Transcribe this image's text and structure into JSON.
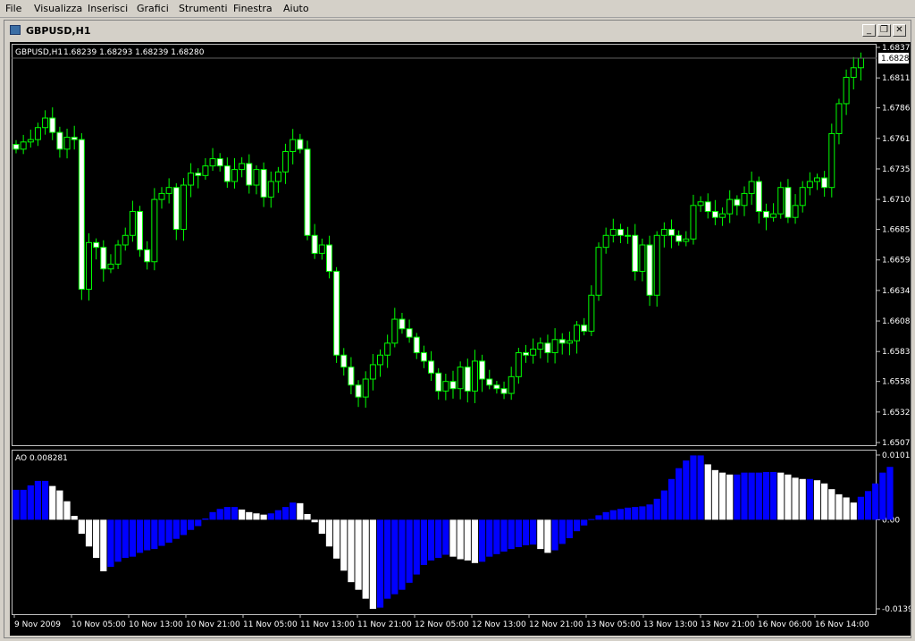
{
  "menu": [
    "File",
    "Visualizza",
    "Inserisci",
    "Grafici",
    "Strumenti",
    "Finestra",
    "Aiuto"
  ],
  "window": {
    "title": "GBPUSD,H1",
    "minimize": "_",
    "restore": "❐",
    "close": "✕"
  },
  "colors": {
    "background": "#000000",
    "candle": "#00ff00",
    "bull_body": "#000000",
    "bear_body": "#ffffff",
    "ao_up": "#0000ff",
    "ao_down": "#ffffff",
    "text": "#ffffff",
    "grid": "#606060"
  },
  "chart_data": [
    {
      "type": "candlestick",
      "title": "GBPUSD,H1",
      "ohlc_label": "1.68239 1.68293 1.68239 1.68280",
      "current_price": "1.68280",
      "ylim": [
        1.6507,
        1.6837
      ],
      "y_ticks": [
        "1.68370",
        "1.68115",
        "1.67865",
        "1.67610",
        "1.67355",
        "1.67100",
        "1.66850",
        "1.66595",
        "1.66340",
        "1.66085",
        "1.65830",
        "1.65580",
        "1.65325",
        "1.65070"
      ],
      "x_ticks": [
        "9 Nov 2009",
        "10 Nov 05:00",
        "10 Nov 13:00",
        "10 Nov 21:00",
        "11 Nov 05:00",
        "11 Nov 13:00",
        "11 Nov 21:00",
        "12 Nov 05:00",
        "12 Nov 13:00",
        "12 Nov 21:00",
        "13 Nov 05:00",
        "13 Nov 13:00",
        "13 Nov 21:00",
        "16 Nov 06:00",
        "16 Nov 14:00"
      ],
      "close": [
        1.6752,
        1.6758,
        1.676,
        1.677,
        1.6778,
        1.6766,
        1.6752,
        1.6762,
        1.676,
        1.6635,
        1.6674,
        1.667,
        1.6652,
        1.6656,
        1.6672,
        1.668,
        1.67,
        1.6668,
        1.6658,
        1.671,
        1.6715,
        1.672,
        1.6685,
        1.6722,
        1.6732,
        1.673,
        1.6738,
        1.6744,
        1.6738,
        1.6725,
        1.6735,
        1.674,
        1.6722,
        1.6735,
        1.6712,
        1.6725,
        1.6733,
        1.675,
        1.676,
        1.6752,
        1.668,
        1.6665,
        1.6672,
        1.665,
        1.658,
        1.657,
        1.6555,
        1.6545,
        1.656,
        1.6572,
        1.658,
        1.659,
        1.661,
        1.6602,
        1.6595,
        1.6582,
        1.6575,
        1.6565,
        1.655,
        1.6558,
        1.6552,
        1.657,
        1.655,
        1.6575,
        1.656,
        1.6555,
        1.6552,
        1.6548,
        1.6562,
        1.6582,
        1.658,
        1.6585,
        1.659,
        1.6582,
        1.6593,
        1.659,
        1.6592,
        1.6605,
        1.66,
        1.663,
        1.667,
        1.668,
        1.6685,
        1.668,
        1.668,
        1.665,
        1.6672,
        1.663,
        1.668,
        1.6685,
        1.668,
        1.6675,
        1.6677,
        1.6705,
        1.6708,
        1.67,
        1.6695,
        1.6698,
        1.671,
        1.6705,
        1.6715,
        1.6725,
        1.67,
        1.6695,
        1.6698,
        1.672,
        1.6695,
        1.6705,
        1.672,
        1.6725,
        1.6728,
        1.672,
        1.6765,
        1.679,
        1.6812,
        1.682,
        1.6828
      ]
    },
    {
      "type": "bar",
      "title": "AO 0.008281",
      "ylim": [
        -0.01399,
        0.01016
      ],
      "y_ticks": [
        "0.010163",
        "0.00",
        "-0.013990"
      ],
      "values": [
        0.0047,
        0.0047,
        0.0054,
        0.0061,
        0.0061,
        0.0053,
        0.0046,
        0.0029,
        0.0006,
        -0.0022,
        -0.0042,
        -0.006,
        -0.0081,
        -0.0074,
        -0.0066,
        -0.006,
        -0.0058,
        -0.0052,
        -0.0048,
        -0.0046,
        -0.0041,
        -0.0036,
        -0.003,
        -0.0024,
        -0.0016,
        -0.001,
        0.0002,
        0.0012,
        0.0017,
        0.002,
        0.002,
        0.0016,
        0.0012,
        0.001,
        0.0008,
        0.001,
        0.0015,
        0.002,
        0.0027,
        0.0026,
        0.0009,
        -0.0004,
        -0.0022,
        -0.0042,
        -0.0061,
        -0.008,
        -0.0098,
        -0.011,
        -0.0124,
        -0.014,
        -0.0138,
        -0.0124,
        -0.0117,
        -0.011,
        -0.0099,
        -0.0086,
        -0.0071,
        -0.0064,
        -0.006,
        -0.0055,
        -0.0058,
        -0.0062,
        -0.0064,
        -0.0068,
        -0.0066,
        -0.0058,
        -0.0054,
        -0.005,
        -0.0046,
        -0.0043,
        -0.004,
        -0.0039,
        -0.0046,
        -0.0052,
        -0.0048,
        -0.0038,
        -0.0029,
        -0.0018,
        -0.0009,
        0.0001,
        0.0007,
        0.0012,
        0.0015,
        0.0017,
        0.0019,
        0.002,
        0.0021,
        0.0024,
        0.0033,
        0.0046,
        0.0064,
        0.0081,
        0.0093,
        0.0101,
        0.0101,
        0.0087,
        0.0078,
        0.0074,
        0.0071,
        0.0071,
        0.0074,
        0.0074,
        0.0074,
        0.0075,
        0.0075,
        0.0074,
        0.0071,
        0.0066,
        0.0064,
        0.0064,
        0.0062,
        0.0057,
        0.0048,
        0.004,
        0.0035,
        0.0027,
        0.0036,
        0.0045,
        0.0057,
        0.0074,
        0.0083
      ]
    }
  ]
}
